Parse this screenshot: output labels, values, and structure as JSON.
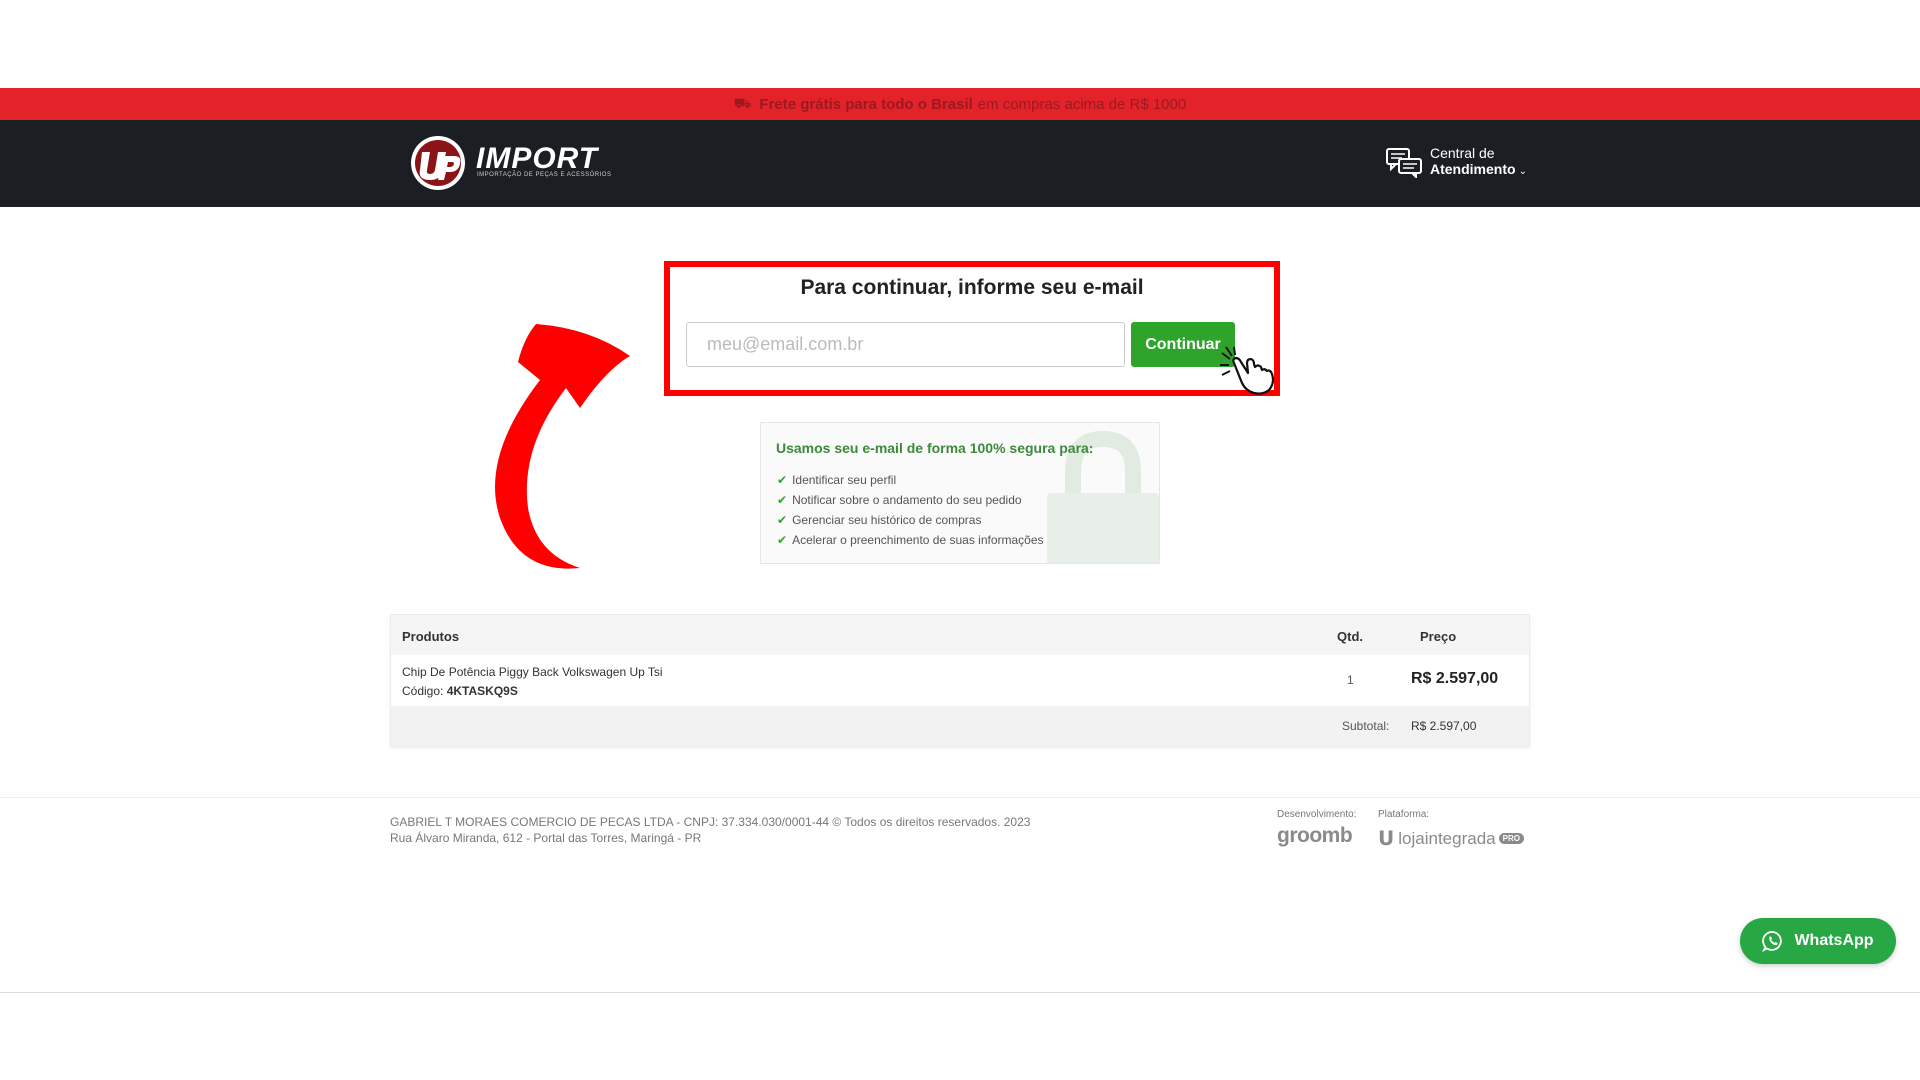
{
  "promo": {
    "bold_text": "Frete grátis para todo o Brasil",
    "rest_text": "em compras acima de R$ 1000"
  },
  "header": {
    "logo_word": "IMPORT",
    "logo_sub": "IMPORTAÇÃO DE PEÇAS E ACESSÓRIOS",
    "support_line1": "Central de",
    "support_line2": "Atendimento"
  },
  "email": {
    "title": "Para continuar, informe seu e-mail",
    "placeholder": "meu@email.com.br",
    "button": "Continuar"
  },
  "secure": {
    "title": "Usamos seu e-mail de forma 100% segura para:",
    "items": [
      "Identificar seu perfil",
      "Notificar sobre o andamento do seu pedido",
      "Gerenciar seu histórico de compras",
      "Acelerar o preenchimento de suas informações"
    ]
  },
  "cart": {
    "col_products": "Produtos",
    "col_qty": "Qtd.",
    "col_price": "Preço",
    "product_name": "Chip De Potência Piggy Back Volkswagen Up Tsi",
    "code_label": "Código:",
    "code_value": "4KTASKQ9S",
    "qty": "1",
    "price": "R$ 2.597,00",
    "subtotal_label": "Subtotal:",
    "subtotal_value": "R$ 2.597,00"
  },
  "footer": {
    "line1": "GABRIEL T MORAES COMERCIO DE PECAS LTDA - CNPJ: 37.334.030/0001-44 © Todos os direitos reservados. 2023",
    "line2": "Rua Álvaro Miranda, 612 - Portal das Torres, Maringá - PR",
    "dev_label": "Desenvolvimento:",
    "plat_label": "Plataforma:",
    "dev_brand": "groomb",
    "plat_brand": "lojaintegrada",
    "plat_badge": "PRO"
  },
  "whatsapp": {
    "label": "WhatsApp"
  },
  "colors": {
    "promo_bar": "#e3222a",
    "header_bg": "#1b1e22",
    "highlight_box": "#ff0000",
    "continue_button": "#2ea42b",
    "whatsapp_button": "#28a745"
  },
  "icons": [
    "truck-icon",
    "logo-emblem",
    "chat-icon",
    "chevron-down-icon",
    "hand-pointer-icon",
    "red-arrow",
    "lock-icon",
    "check-icon",
    "whatsapp-icon"
  ]
}
